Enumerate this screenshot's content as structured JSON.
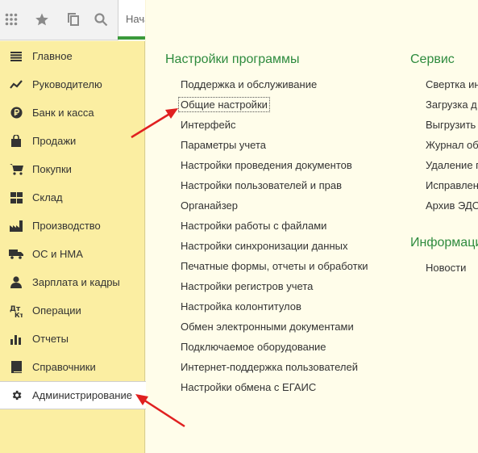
{
  "toolbar": {
    "icons": [
      "grid-icon",
      "star-icon",
      "history-icon",
      "search-icon"
    ],
    "tab_label": "Нача"
  },
  "sidebar": {
    "items": [
      {
        "label": "Главное",
        "icon": "menu-icon"
      },
      {
        "label": "Руководителю",
        "icon": "trend-icon"
      },
      {
        "label": "Банк и касса",
        "icon": "ruble-icon"
      },
      {
        "label": "Продажи",
        "icon": "bag-icon"
      },
      {
        "label": "Покупки",
        "icon": "cart-icon"
      },
      {
        "label": "Склад",
        "icon": "warehouse-icon"
      },
      {
        "label": "Производство",
        "icon": "factory-icon"
      },
      {
        "label": "ОС и НМА",
        "icon": "truck-icon"
      },
      {
        "label": "Зарплата и кадры",
        "icon": "person-icon"
      },
      {
        "label": "Операции",
        "icon": "operations-icon"
      },
      {
        "label": "Отчеты",
        "icon": "chart-icon"
      },
      {
        "label": "Справочники",
        "icon": "book-icon"
      },
      {
        "label": "Администрирование",
        "icon": "gear-icon",
        "active": true
      }
    ]
  },
  "settings": {
    "title": "Настройки программы",
    "items": [
      "Поддержка и обслуживание",
      "Общие настройки",
      "Интерфейс",
      "Параметры учета",
      "Настройки проведения документов",
      "Настройки пользователей и прав",
      "Органайзер",
      "Настройки работы с файлами",
      "Настройки синхронизации данных",
      "Печатные формы, отчеты и обработки",
      "Настройки регистров учета",
      "Настройка колонтитулов",
      "Обмен электронными документами",
      "Подключаемое оборудование",
      "Интернет-поддержка пользователей",
      "Настройки обмена с ЕГАИС"
    ]
  },
  "service": {
    "title": "Сервис",
    "items": [
      "Свертка ин",
      "Загрузка д",
      "Выгрузить",
      "Журнал об",
      "Удаление п",
      "Исправлен",
      "Архив ЭДО"
    ]
  },
  "info": {
    "title": "Информаци",
    "items": [
      "Новости"
    ]
  },
  "colors": {
    "sidebar_bg": "#fbeea2",
    "main_bg": "#fffdea",
    "section_title": "#2e8b3e",
    "arrow": "#e02020"
  }
}
